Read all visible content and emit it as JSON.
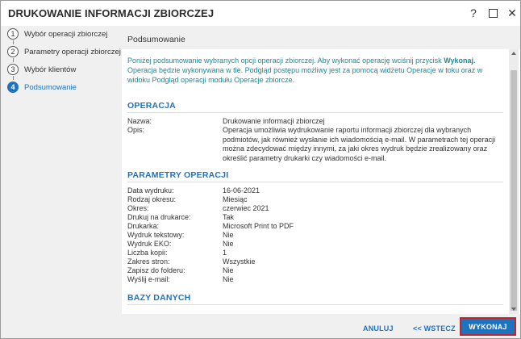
{
  "window": {
    "title": "DRUKOWANIE INFORMACJI ZBIORCZEJ",
    "help_label": "?",
    "close_label": "✕"
  },
  "steps": [
    {
      "number": "1",
      "label": "Wybór operacji zbiorczej"
    },
    {
      "number": "2",
      "label": "Parametry operacji zbiorczej"
    },
    {
      "number": "3",
      "label": "Wybór klientów"
    },
    {
      "number": "4",
      "label": "Podsumowanie"
    }
  ],
  "content": {
    "title": "Podsumowanie",
    "intro_part1": "Poniżej podsumowanie wybranych opcji operacji zbiorczej. Aby wykonać operację wciśnij przycisk ",
    "intro_bold": "Wykonaj.",
    "intro_part2": " Operacja będzie wykonywana w tle. Podgląd postępu możliwy jest za pomocą widżetu Operacje w toku oraz w widoku Podgląd operacji modułu Operacje zbiorcze.",
    "sections": {
      "operacja": {
        "title": "OPERACJA",
        "rows": [
          {
            "label": "Nazwa:",
            "value": "Drukowanie informacji zbiorczej"
          },
          {
            "label": "Opis:",
            "value": "Operacja umożliwia wydrukowanie raportu informacji zbiorczej dla wybranych podmiotów, jak również wysłanie ich wiadomością e-mail. W parametrach tej operacji można zdecydować między innymi, za jaki okres wydruk będzie zrealizowany oraz określić parametry drukarki czy wiadomości e-mail."
          }
        ]
      },
      "parametry": {
        "title": "PARAMETRY OPERACJI",
        "rows": [
          {
            "label": "Data wydruku:",
            "value": "16-06-2021"
          },
          {
            "label": "Rodzaj okresu:",
            "value": "Miesiąc"
          },
          {
            "label": "Okres:",
            "value": "czerwiec 2021"
          },
          {
            "label": "Drukuj na drukarce:",
            "value": "Tak"
          },
          {
            "label": "Drukarka:",
            "value": "Microsoft Print to PDF"
          },
          {
            "label": "Wydruk tekstowy:",
            "value": "Nie"
          },
          {
            "label": "Wydruk EKO:",
            "value": "Nie"
          },
          {
            "label": "Liczba kopii:",
            "value": "1"
          },
          {
            "label": "Zakres stron:",
            "value": "Wszystkie"
          },
          {
            "label": "Zapisz do folderu:",
            "value": "Nie"
          },
          {
            "label": "Wyślij e-mail:",
            "value": "Nie"
          }
        ]
      },
      "bazy": {
        "title": "BAZY DANYCH"
      }
    }
  },
  "footer": {
    "cancel_label": "ANULUJ",
    "back_label": "<< WSTECZ",
    "execute_label": "WYKONAJ"
  },
  "colors": {
    "accent": "#1e73be",
    "intro_text": "#1a8a9a",
    "focus_border": "#c0272d"
  },
  "icons": {
    "help": "question-mark",
    "maximize": "square-outline",
    "close": "x-cross"
  }
}
